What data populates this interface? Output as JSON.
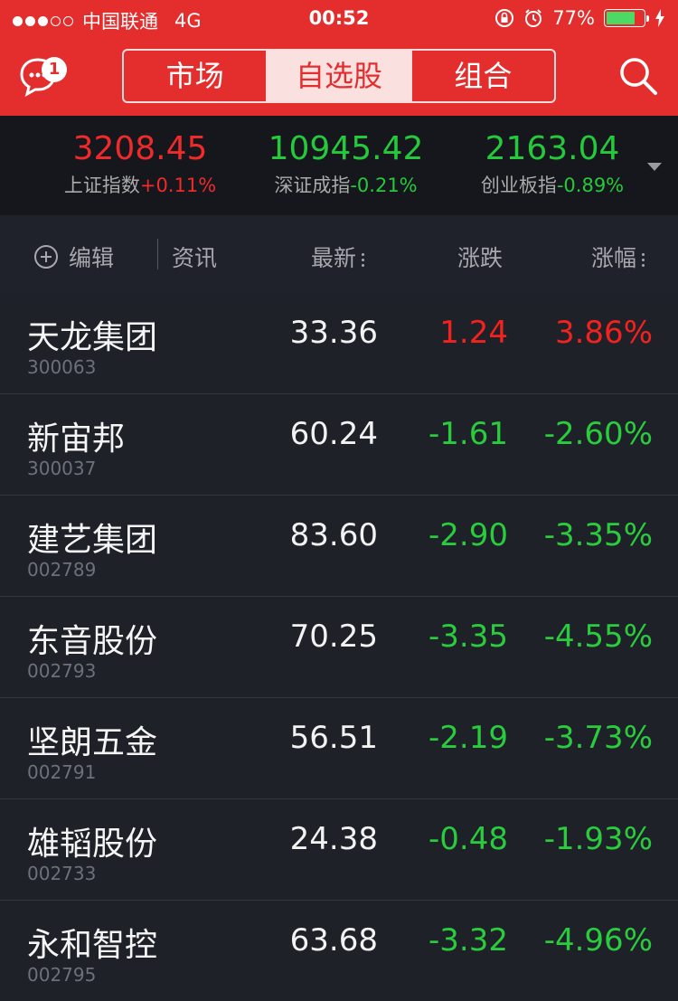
{
  "status_bar": {
    "signal_dots_filled": 3,
    "signal_dots_total": 5,
    "carrier": "中国联通",
    "network": "4G",
    "time": "00:52",
    "battery_percent": "77%",
    "battery_level": 0.77,
    "icons": [
      "rotation-lock-icon",
      "alarm-icon",
      "battery-icon",
      "charging-icon"
    ]
  },
  "header": {
    "message_badge": "1",
    "tabs": [
      {
        "label": "市场",
        "active": false
      },
      {
        "label": "自选股",
        "active": true
      },
      {
        "label": "组合",
        "active": false
      }
    ]
  },
  "indices": [
    {
      "value": "3208.45",
      "name": "上证指数",
      "change": "+0.11%",
      "direction": "up"
    },
    {
      "value": "10945.42",
      "name": "深证成指",
      "change": "-0.21%",
      "direction": "down"
    },
    {
      "value": "2163.04",
      "name": "创业板指",
      "change": "-0.89%",
      "direction": "down"
    }
  ],
  "table_header": {
    "edit": "编辑",
    "news": "资讯",
    "latest": "最新",
    "change": "涨跌",
    "pct": "涨幅"
  },
  "stocks": [
    {
      "name": "天龙集团",
      "code": "300063",
      "last": "33.36",
      "change": "1.24",
      "pct": "3.86%",
      "direction": "up"
    },
    {
      "name": "新宙邦",
      "code": "300037",
      "last": "60.24",
      "change": "-1.61",
      "pct": "-2.60%",
      "direction": "down"
    },
    {
      "name": "建艺集团",
      "code": "002789",
      "last": "83.60",
      "change": "-2.90",
      "pct": "-3.35%",
      "direction": "down"
    },
    {
      "name": "东音股份",
      "code": "002793",
      "last": "70.25",
      "change": "-3.35",
      "pct": "-4.55%",
      "direction": "down"
    },
    {
      "name": "坚朗五金",
      "code": "002791",
      "last": "56.51",
      "change": "-2.19",
      "pct": "-3.73%",
      "direction": "down"
    },
    {
      "name": "雄韬股份",
      "code": "002733",
      "last": "24.38",
      "change": "-0.48",
      "pct": "-1.93%",
      "direction": "down"
    },
    {
      "name": "永和智控",
      "code": "002795",
      "last": "63.68",
      "change": "-3.32",
      "pct": "-4.96%",
      "direction": "down"
    }
  ],
  "colors": {
    "brand_red": "#e42d2d",
    "up_red": "#f2221f",
    "down_green": "#29cc3c",
    "background": "#1f2129"
  }
}
